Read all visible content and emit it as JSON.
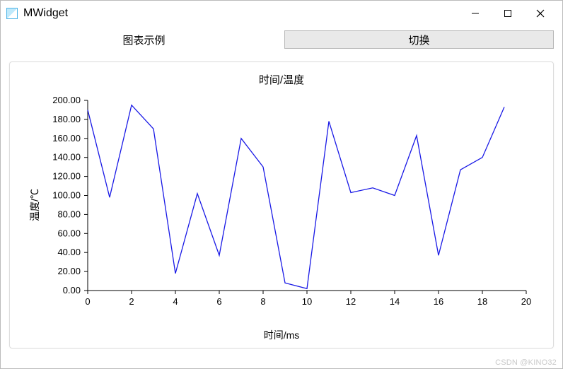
{
  "window": {
    "title": "MWidget"
  },
  "toolbar": {
    "example_label": "图表示例",
    "switch_label": "切换"
  },
  "watermark": "CSDN @KINO32",
  "chart_data": {
    "type": "line",
    "title": "时间/温度",
    "xlabel": "时间/ms",
    "ylabel": "温度/℃",
    "xlim": [
      0,
      20
    ],
    "ylim": [
      0,
      200
    ],
    "xticks": [
      0,
      2,
      4,
      6,
      8,
      10,
      12,
      14,
      16,
      18,
      20
    ],
    "yticks": [
      0.0,
      20.0,
      40.0,
      60.0,
      80.0,
      100.0,
      120.0,
      140.0,
      160.0,
      180.0,
      200.0
    ],
    "x": [
      0,
      1,
      2,
      3,
      4,
      5,
      6,
      7,
      8,
      9,
      10,
      11,
      12,
      13,
      14,
      15,
      16,
      17,
      18,
      19
    ],
    "values": [
      190,
      98,
      195,
      170,
      18,
      102,
      37,
      160,
      130,
      8,
      2,
      178,
      103,
      108,
      100,
      163,
      37,
      127,
      140,
      193
    ]
  }
}
